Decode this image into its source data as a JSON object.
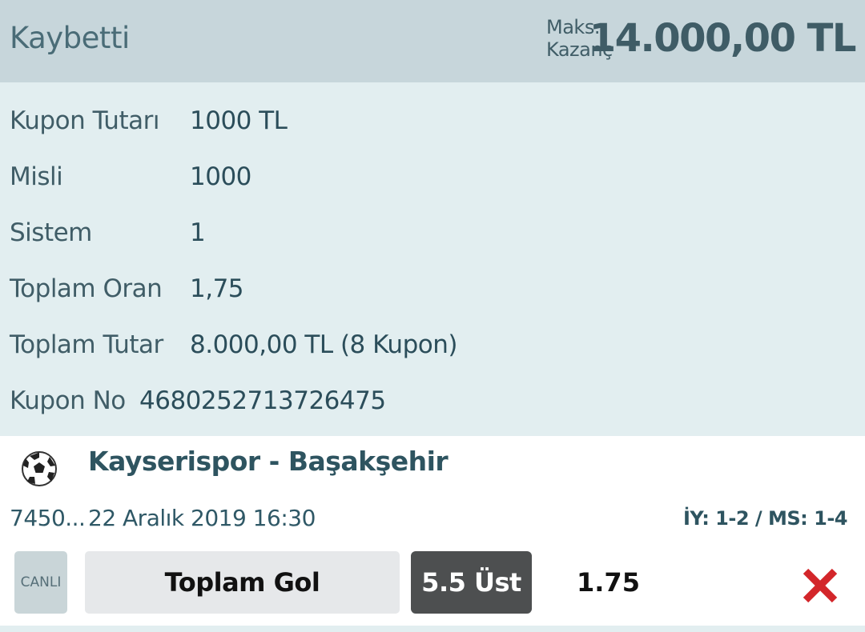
{
  "header": {
    "status": "Kaybetti",
    "max_label_line1": "Maks.",
    "max_label_line2": "Kazanç",
    "max_value": "14.000,00 TL"
  },
  "details": [
    {
      "label": "Kupon Tutarı",
      "value": "1000 TL"
    },
    {
      "label": "Misli",
      "value": "1000"
    },
    {
      "label": "Sistem",
      "value": "1"
    },
    {
      "label": "Toplam Oran",
      "value": "1,75"
    },
    {
      "label": "Toplam Tutar",
      "value": "8.000,00 TL (8 Kupon)"
    },
    {
      "label": "Kupon No",
      "value": "4680252713726475"
    }
  ],
  "match": {
    "sport_icon": "soccer-ball-icon",
    "title": "Kayserispor - Başakşehir",
    "code": "7450...",
    "date": "22 Aralık 2019 16:30",
    "score": "İY: 1-2 / MS: 1-4",
    "live_label": "CANLI",
    "market": "Toplam Gol",
    "pick": "5.5 Üst",
    "odd": "1.75",
    "result_icon": "lost-x-icon"
  },
  "colors": {
    "header_bg": "#c7d6db",
    "details_bg": "#e2eef0",
    "lost_red": "#d3262a",
    "pick_bg": "#4d4f50"
  }
}
